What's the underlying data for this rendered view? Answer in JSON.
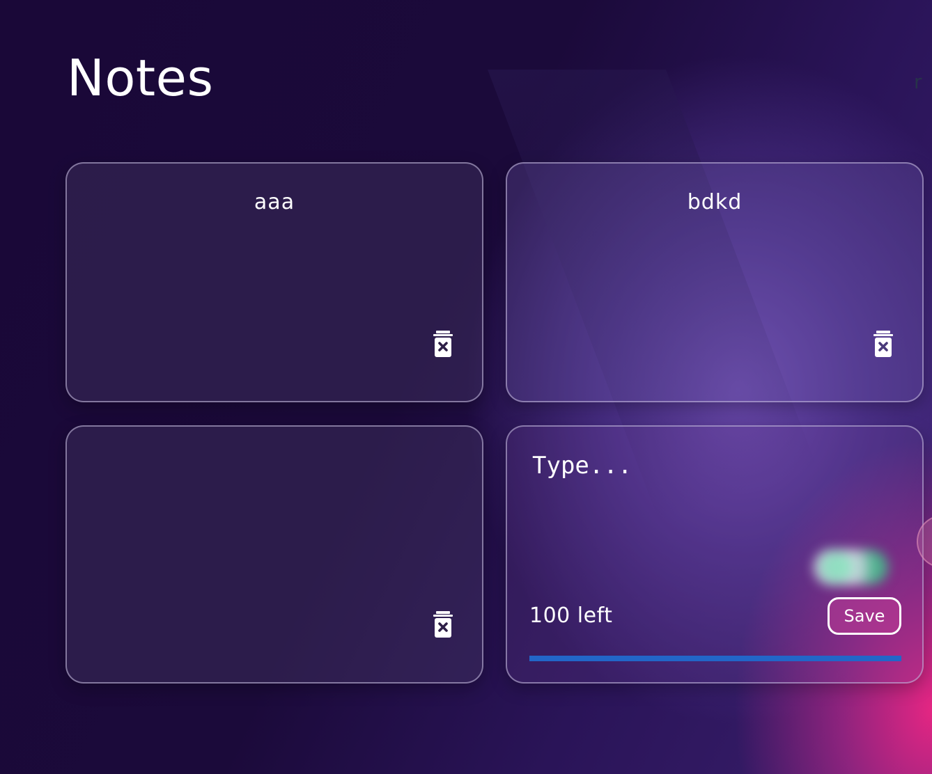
{
  "header": {
    "title": "Notes",
    "corner_glyph": "r"
  },
  "notes": [
    {
      "text": "aaa"
    },
    {
      "text": "bdkd"
    },
    {
      "text": ""
    }
  ],
  "composer": {
    "placeholder": "Type...",
    "chars_left_label": "100 left",
    "save_label": "Save",
    "progress_fraction": 1.0
  },
  "icons": {
    "delete": "trash-x-icon"
  },
  "colors": {
    "progress": "#2266c8",
    "accent_pink": "#ee2684",
    "accent_purple": "#6f4eb4",
    "background": "#170833"
  }
}
